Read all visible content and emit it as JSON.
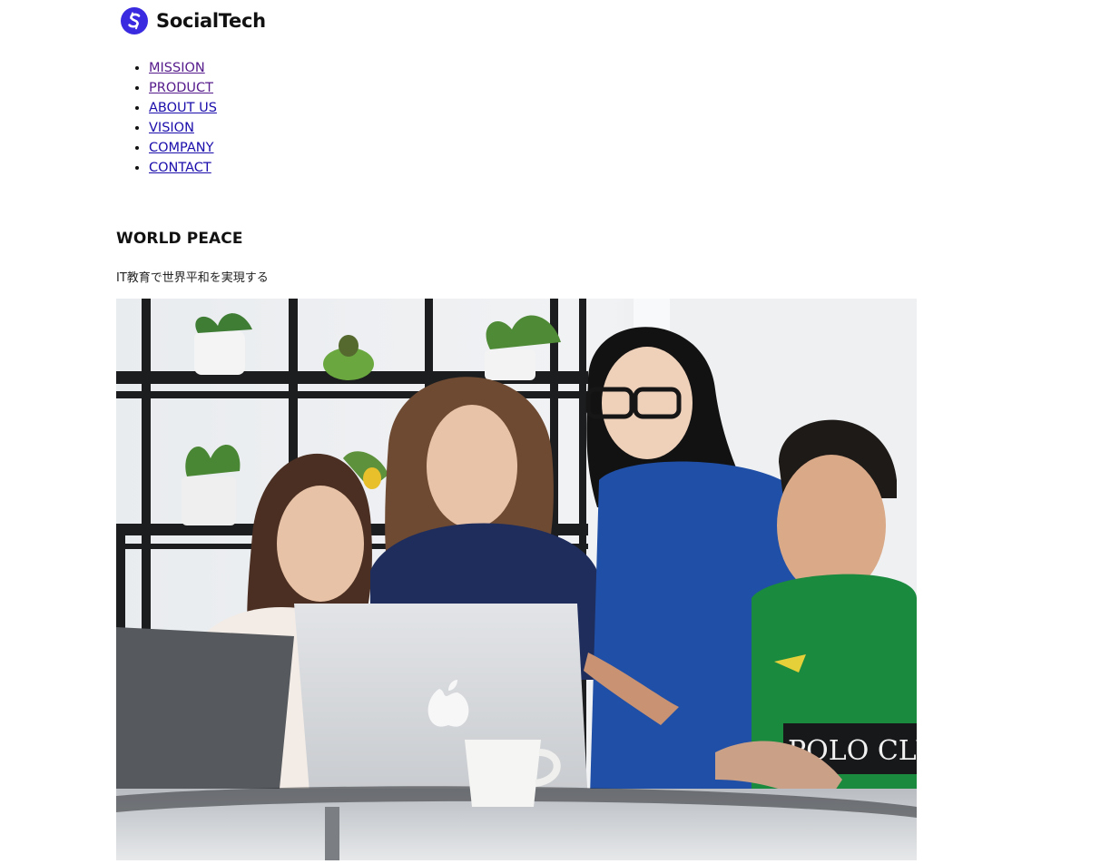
{
  "brand": {
    "name": "SocialTech",
    "logo_icon": "s-logo-icon",
    "logo_color": "#3a2be0"
  },
  "nav": {
    "items": [
      {
        "label": "MISSION",
        "visited": true
      },
      {
        "label": "PRODUCT",
        "visited": true
      },
      {
        "label": "ABOUT US",
        "visited": false
      },
      {
        "label": "VISION",
        "visited": false
      },
      {
        "label": "COMPANY",
        "visited": false
      },
      {
        "label": "CONTACT",
        "visited": false
      }
    ],
    "link_color": "#1a0dab",
    "visited_color": "#551a8b"
  },
  "hero": {
    "title": "WORLD PEACE",
    "subtitle": "IT教育で世界平和を実現する"
  }
}
